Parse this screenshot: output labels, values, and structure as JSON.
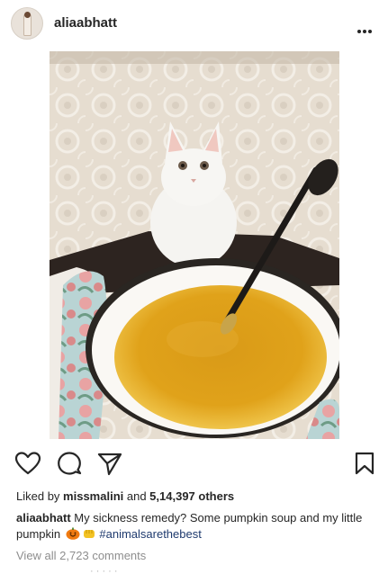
{
  "post": {
    "username": "aliaabhatt",
    "more_icon": "more-horizontal-icon",
    "photo_description_icon": "photo",
    "likes": {
      "prefix": "Liked by ",
      "user": "missmalini",
      "middle": " and ",
      "count": "5,14,397 others"
    },
    "caption": {
      "user": "aliaabhatt",
      "text": " My sickness remedy? Some pumpkin soup and my little pumpkin ",
      "hashtag": "#animalsarethebest"
    },
    "comments_link": "View all 2,723 comments",
    "cut_text": "· · · · ·"
  },
  "icons": {
    "like": "heart-icon",
    "comment": "comment-icon",
    "share": "send-icon",
    "save": "bookmark-icon"
  },
  "colors": {
    "text": "#262626",
    "muted": "#8e8e8e",
    "hashtag": "#1e3a6e"
  }
}
